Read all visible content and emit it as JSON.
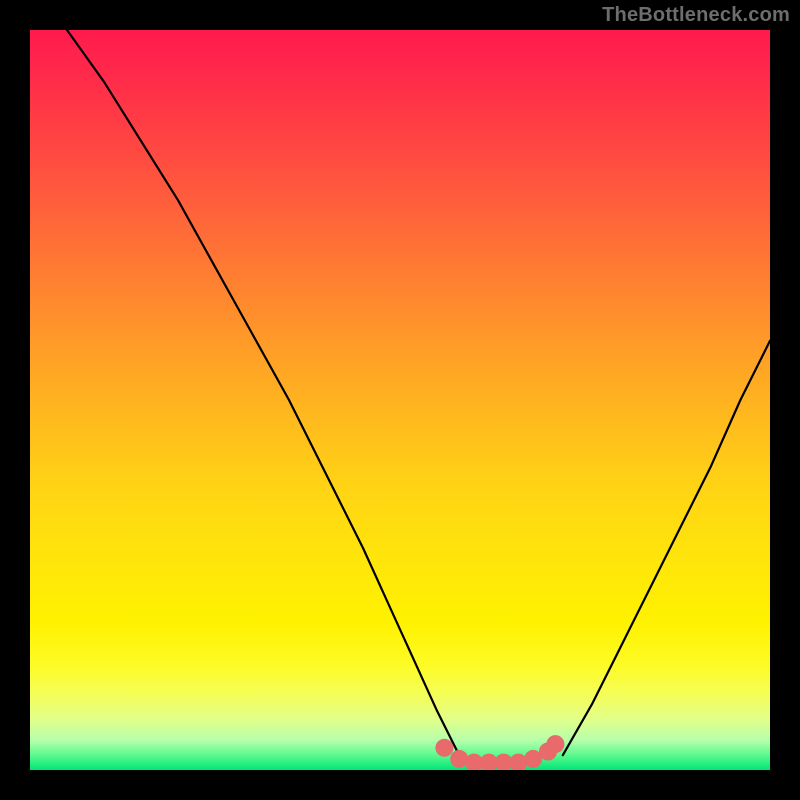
{
  "watermark": "TheBottleneck.com",
  "colors": {
    "frame_bg": "#000000",
    "gradient_top": "#ff1a4d",
    "gradient_mid": "#ffe60a",
    "gradient_bottom": "#00e676",
    "curve": "#000000",
    "marker": "#e86a6a"
  },
  "chart_data": {
    "type": "line",
    "title": "",
    "xlabel": "",
    "ylabel": "",
    "xlim": [
      0,
      100
    ],
    "ylim": [
      0,
      100
    ],
    "series": [
      {
        "name": "left-branch",
        "x": [
          5,
          10,
          15,
          20,
          25,
          30,
          35,
          40,
          45,
          50,
          55,
          58
        ],
        "values": [
          100,
          93,
          85,
          77,
          68,
          59,
          50,
          40,
          30,
          19,
          8,
          2
        ]
      },
      {
        "name": "right-branch",
        "x": [
          72,
          76,
          80,
          84,
          88,
          92,
          96,
          100
        ],
        "values": [
          2,
          9,
          17,
          25,
          33,
          41,
          50,
          58
        ]
      }
    ],
    "markers": {
      "name": "bottom-cluster",
      "points": [
        {
          "x": 56,
          "y": 3
        },
        {
          "x": 58,
          "y": 1.5
        },
        {
          "x": 60,
          "y": 1
        },
        {
          "x": 62,
          "y": 1
        },
        {
          "x": 64,
          "y": 1
        },
        {
          "x": 66,
          "y": 1
        },
        {
          "x": 68,
          "y": 1.5
        },
        {
          "x": 70,
          "y": 2.5
        },
        {
          "x": 71,
          "y": 3.5
        }
      ]
    }
  }
}
